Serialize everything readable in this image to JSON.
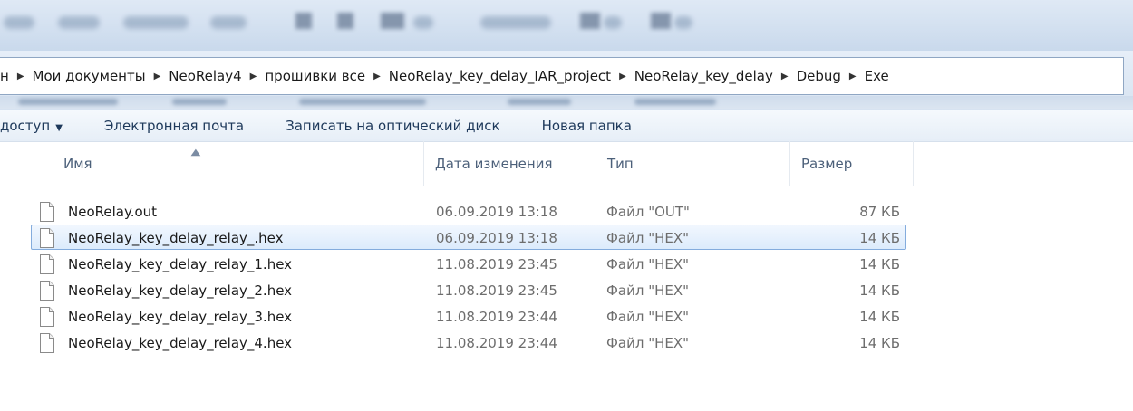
{
  "breadcrumb": {
    "items": [
      "н",
      "Мои документы",
      "NeoRelay4",
      "прошивки все",
      "NeoRelay_key_delay_IAR_project",
      "NeoRelay_key_delay",
      "Debug",
      "Exe"
    ]
  },
  "commands": {
    "share": "доступ",
    "email": "Электронная почта",
    "burn": "Записать на оптический диск",
    "new_folder": "Новая папка"
  },
  "columns": {
    "name": "Имя",
    "date": "Дата изменения",
    "type": "Тип",
    "size": "Размер"
  },
  "files": [
    {
      "name": "NeoRelay.out",
      "date": "06.09.2019 13:18",
      "type": "Файл \"OUT\"",
      "size": "87 КБ",
      "selected": false
    },
    {
      "name": "NeoRelay_key_delay_relay_.hex",
      "date": "06.09.2019 13:18",
      "type": "Файл \"HEX\"",
      "size": "14 КБ",
      "selected": true
    },
    {
      "name": "NeoRelay_key_delay_relay_1.hex",
      "date": "11.08.2019 23:45",
      "type": "Файл \"HEX\"",
      "size": "14 КБ",
      "selected": false
    },
    {
      "name": "NeoRelay_key_delay_relay_2.hex",
      "date": "11.08.2019 23:45",
      "type": "Файл \"HEX\"",
      "size": "14 КБ",
      "selected": false
    },
    {
      "name": "NeoRelay_key_delay_relay_3.hex",
      "date": "11.08.2019 23:44",
      "type": "Файл \"HEX\"",
      "size": "14 КБ",
      "selected": false
    },
    {
      "name": "NeoRelay_key_delay_relay_4.hex",
      "date": "11.08.2019 23:44",
      "type": "Файл \"HEX\"",
      "size": "14 КБ",
      "selected": false
    }
  ]
}
